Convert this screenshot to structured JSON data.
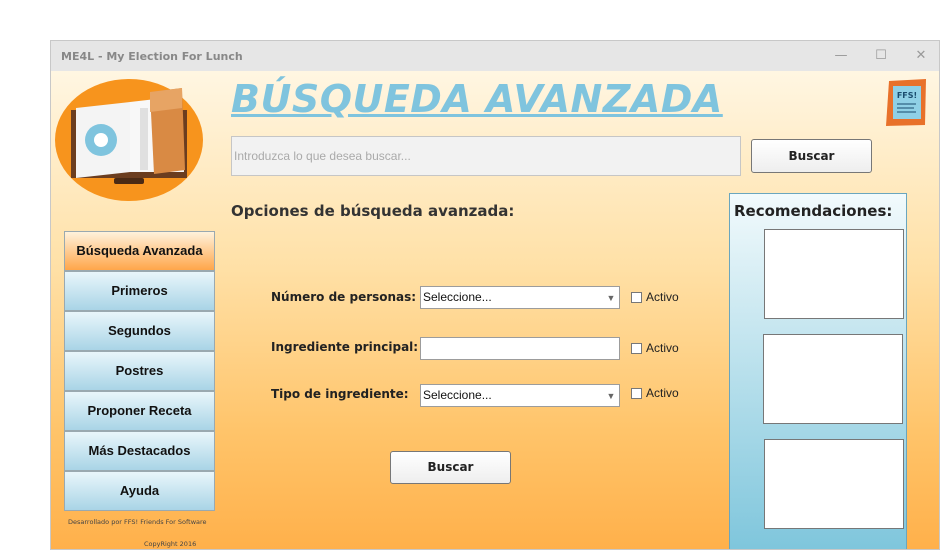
{
  "window": {
    "title": "ME4L - My Election For Lunch",
    "controls": {
      "minimize": "—",
      "maximize": "☐",
      "close": "✕"
    }
  },
  "header": {
    "heading": "BÚSQUEDA AVANZADA",
    "search_placeholder": "Introduzca lo que desea buscar...",
    "search_button": "Buscar",
    "brand_logo_text": "FFS!"
  },
  "sidebar": {
    "items": [
      {
        "label": "Búsqueda Avanzada",
        "active": true
      },
      {
        "label": "Primeros",
        "active": false
      },
      {
        "label": "Segundos",
        "active": false
      },
      {
        "label": "Postres",
        "active": false
      },
      {
        "label": "Proponer Receta",
        "active": false
      },
      {
        "label": "Más Destacados",
        "active": false
      },
      {
        "label": "Ayuda",
        "active": false
      }
    ],
    "footer_line1": "Desarrollado por FFS! Friends For Software",
    "footer_line2": "CopyRight 2016"
  },
  "options": {
    "title": "Opciones de búsqueda avanzada:",
    "rows": [
      {
        "label": "Número de personas:",
        "value": "Seleccione...",
        "checkbox_label": "Activo"
      },
      {
        "label": "Ingrediente principal:",
        "value": "",
        "checkbox_label": "Activo"
      },
      {
        "label": "Tipo de ingrediente:",
        "value": "Seleccione...",
        "checkbox_label": "Activo"
      }
    ],
    "search_button": "Buscar"
  },
  "recommendations": {
    "title": "Recomendaciones:"
  },
  "colors": {
    "heading": "#7fc4de",
    "active_nav": "#ffa64a",
    "nav": "#a9d4e6",
    "background_bottom": "#ffb04a"
  }
}
